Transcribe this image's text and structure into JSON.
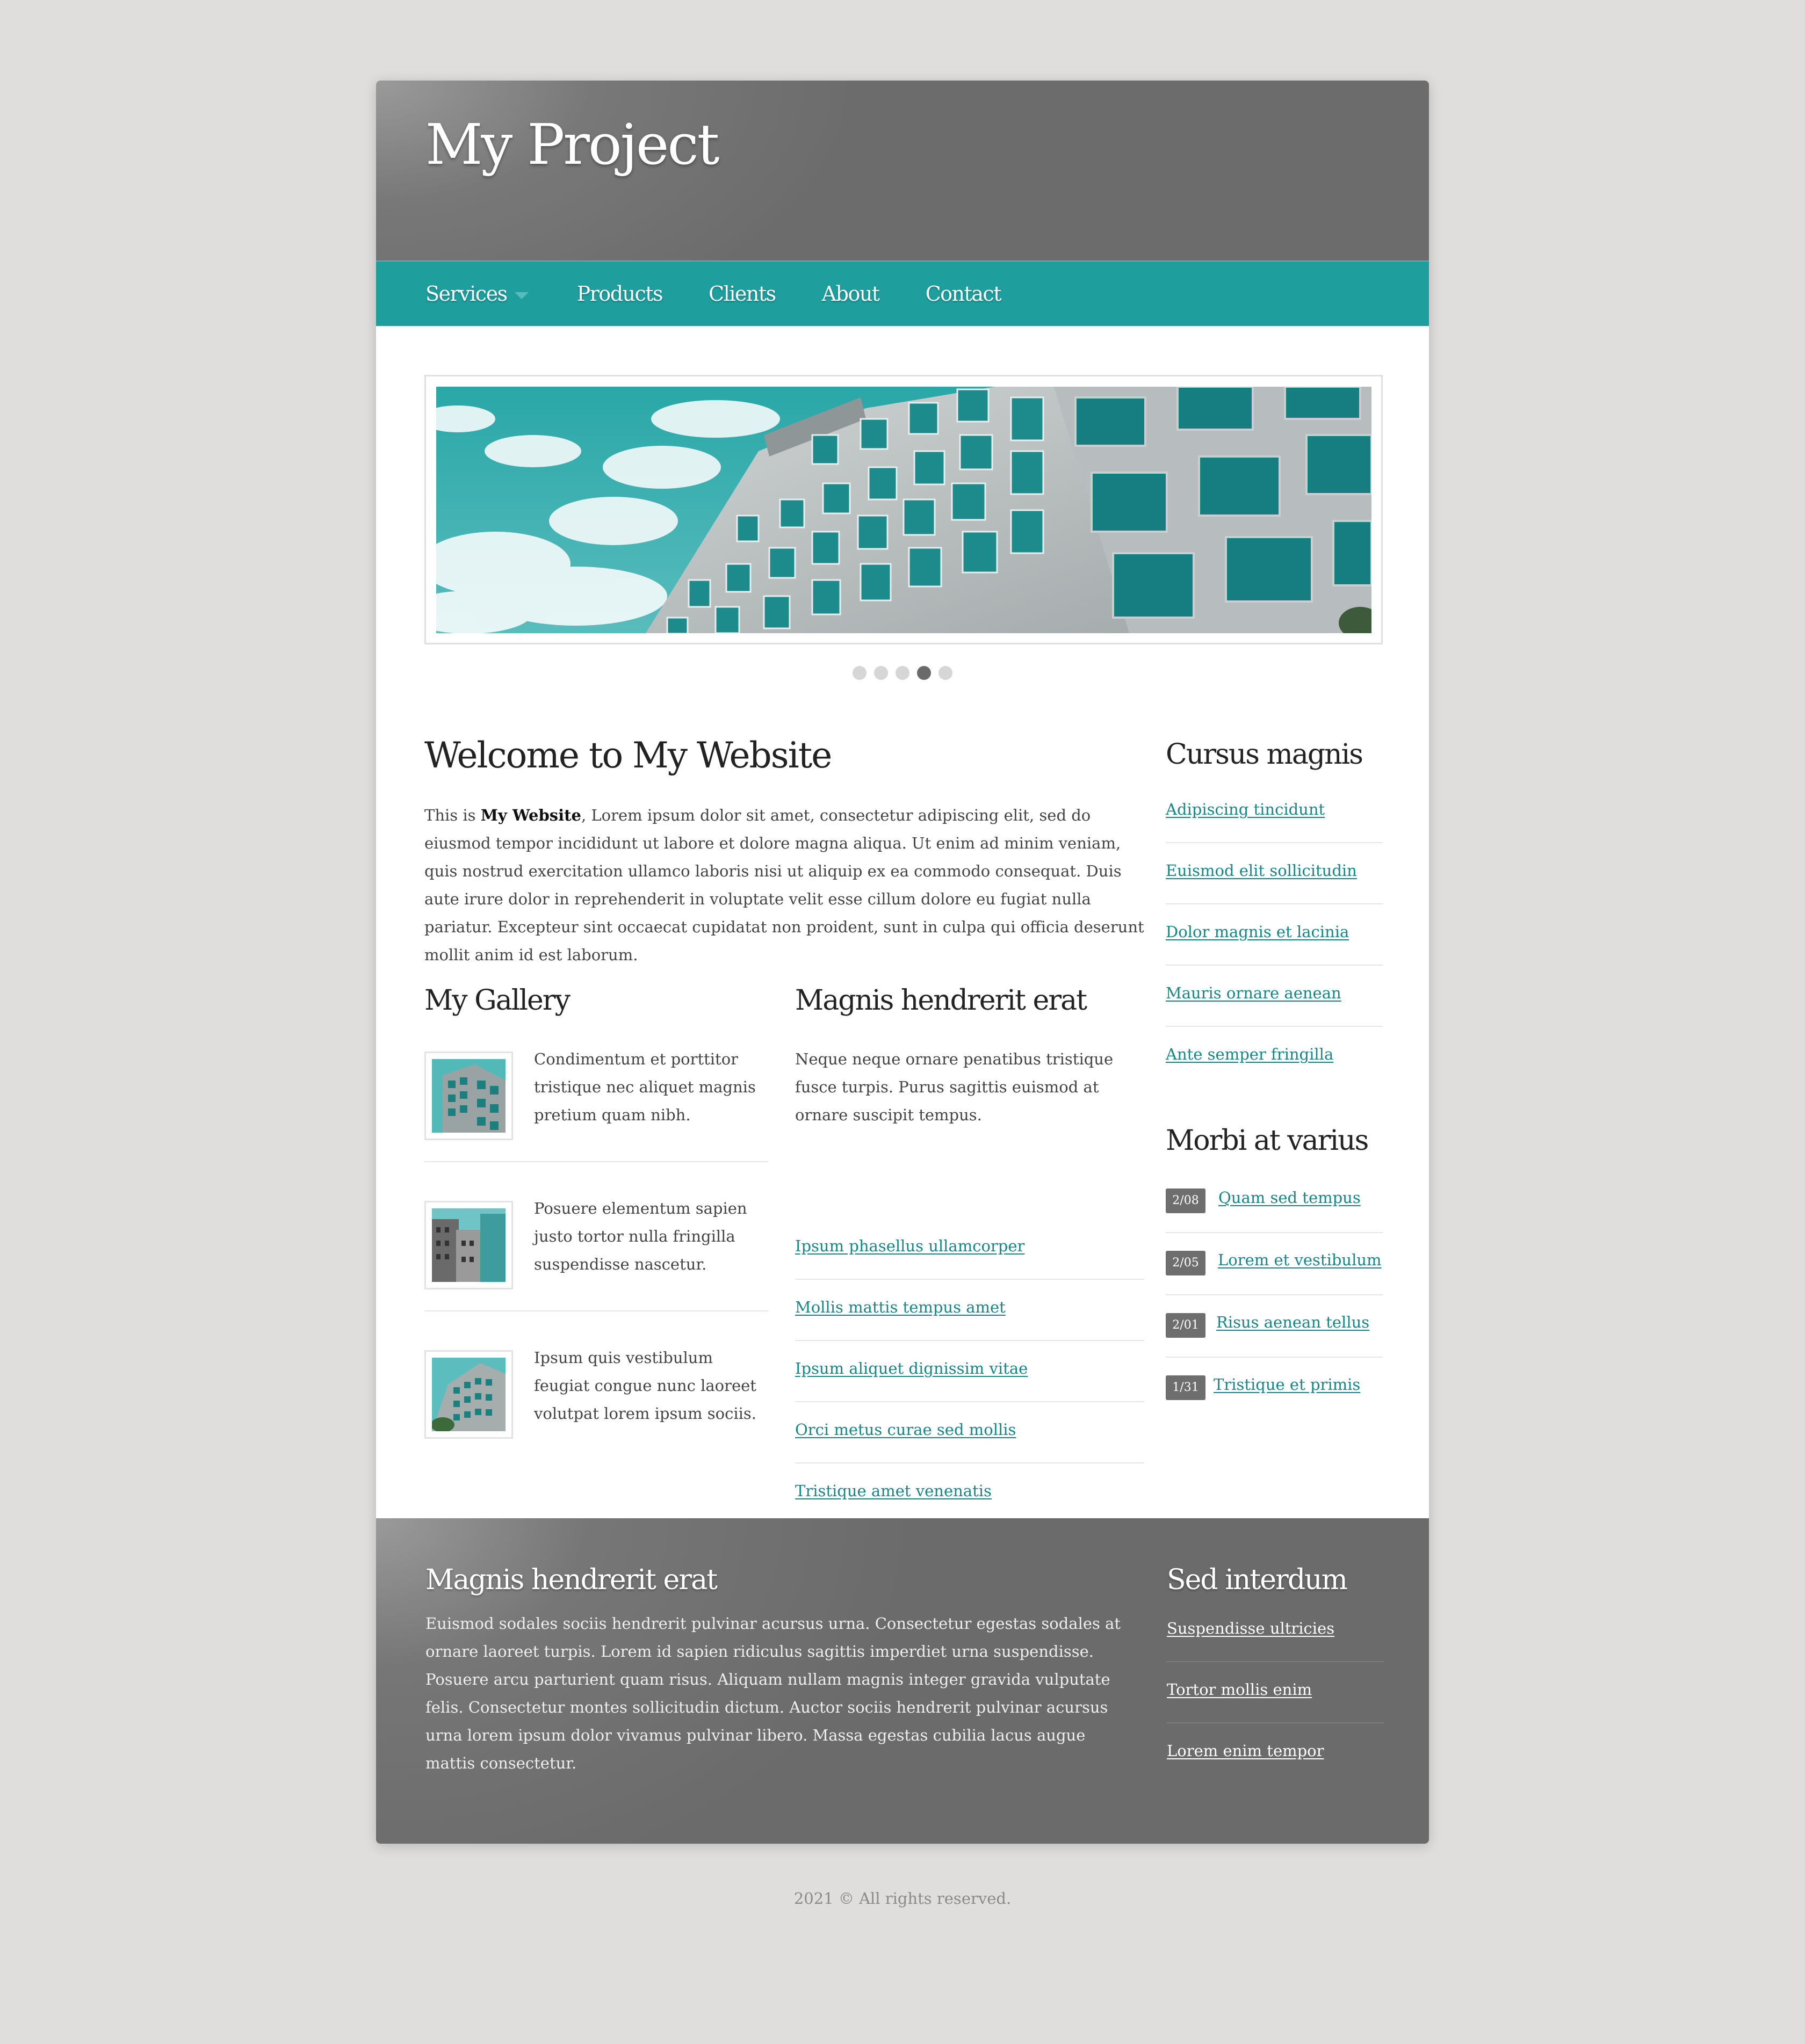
{
  "site": {
    "title": "My Project"
  },
  "nav": {
    "items": [
      {
        "label": "Services",
        "has_dropdown": true
      },
      {
        "label": "Products"
      },
      {
        "label": "Clients"
      },
      {
        "label": "About"
      },
      {
        "label": "Contact"
      }
    ]
  },
  "slider": {
    "slide_count": 5,
    "active_index": 3
  },
  "main": {
    "heading": "Welcome to My Website",
    "intro_prefix": "This is ",
    "intro_bold": "My Website",
    "intro_rest": ", Lorem ipsum dolor sit amet, consectetur adipiscing elit, sed do eiusmod tempor incididunt ut labore et dolore magna aliqua. Ut enim ad minim veniam, quis nostrud exercitation ullamco laboris nisi ut aliquip ex ea commodo consequat. Duis aute irure dolor in reprehenderit in voluptate velit esse cillum dolore eu fugiat nulla pariatur. Excepteur sint occaecat cupidatat non proident, sunt in culpa qui officia deserunt mollit anim id est laborum."
  },
  "gallery": {
    "heading": "My Gallery",
    "items": [
      {
        "text": "Condimentum et porttitor tristique nec aliquet magnis pretium quam nibh."
      },
      {
        "text": "Posuere elementum sapien justo tortor nulla fringilla suspendisse nascetur."
      },
      {
        "text": "Ipsum quis vestibulum feugiat congue nunc laoreet volutpat lorem ipsum sociis."
      }
    ]
  },
  "middle": {
    "heading": "Magnis hendrerit erat",
    "text": "Neque neque ornare penatibus tristique fusce turpis. Purus sagittis euismod at ornare suscipit tempus.",
    "links": [
      "Ipsum phasellus ullamcorper",
      "Mollis mattis tempus amet",
      "Ipsum aliquet dignissim vitae",
      "Orci metus curae sed mollis",
      "Tristique amet venenatis"
    ]
  },
  "sidebar": {
    "cursus": {
      "heading": "Cursus magnis",
      "links": [
        "Adipiscing tincidunt",
        "Euismod elit sollicitudin",
        "Dolor magnis et lacinia",
        "Mauris ornare aenean",
        "Ante semper fringilla"
      ]
    },
    "morbi": {
      "heading": "Morbi at varius",
      "items": [
        {
          "date": "2/08",
          "label": "Quam sed tempus"
        },
        {
          "date": "2/05",
          "label": "Lorem et vestibulum"
        },
        {
          "date": "2/01",
          "label": "Risus aenean tellus"
        },
        {
          "date": "1/31",
          "label": "Tristique et primis"
        }
      ]
    }
  },
  "footer_panel": {
    "left": {
      "heading": "Magnis hendrerit erat",
      "text": "Euismod sodales sociis hendrerit pulvinar acursus urna. Consectetur egestas sodales at ornare laoreet turpis. Lorem id sapien ridiculus sagittis imperdiet urna suspendisse. Posuere arcu parturient quam risus. Aliquam nullam magnis integer gravida vulputate felis. Consectetur montes sollicitudin dictum. Auctor sociis hendrerit pulvinar acursus urna lorem ipsum dolor vivamus pulvinar libero. Massa egestas cubilia lacus augue mattis consectetur."
    },
    "right": {
      "heading": "Sed interdum",
      "links": [
        "Suspendisse ultricies",
        "Tortor mollis enim",
        "Lorem enim tempor"
      ]
    }
  },
  "copyright": "2021 © All rights reserved.",
  "colors": {
    "accent": "#1f9e9e",
    "link": "#168686",
    "header_gray": "#6e6e6e",
    "page_bg": "#dfdedd"
  }
}
